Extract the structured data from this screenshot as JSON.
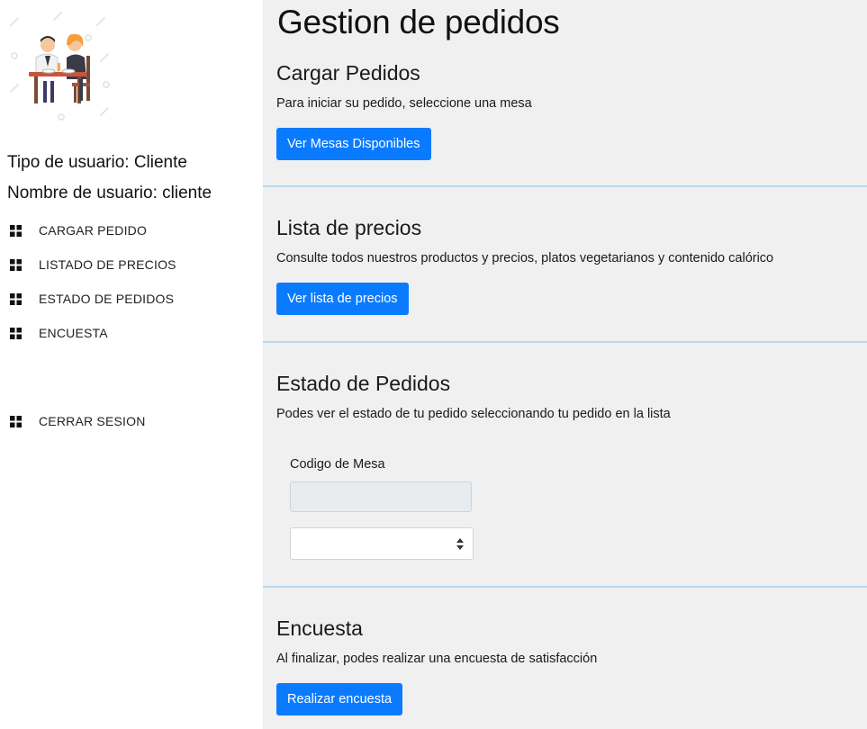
{
  "sidebar": {
    "user_type": "Tipo de usuario: Cliente",
    "user_name": "Nombre de usuario: cliente",
    "nav": [
      {
        "label": "CARGAR PEDIDO",
        "icon": "grid-icon"
      },
      {
        "label": "LISTADO DE PRECIOS",
        "icon": "grid-icon"
      },
      {
        "label": "ESTADO DE PEDIDOS",
        "icon": "grid-icon"
      },
      {
        "label": "ENCUESTA",
        "icon": "grid-icon"
      },
      {
        "label": "CERRAR SESION",
        "icon": "grid-icon"
      }
    ]
  },
  "main": {
    "title": "Gestion de pedidos",
    "sections": [
      {
        "title": "Cargar Pedidos",
        "text": "Para iniciar su pedido, seleccione una mesa",
        "button": "Ver Mesas Disponibles"
      },
      {
        "title": "Lista de precios",
        "text": "Consulte todos nuestros productos y precios, platos vegetarianos y contenido calórico",
        "button": "Ver lista de precios"
      },
      {
        "title": "Estado de Pedidos",
        "text": "Podes ver el estado de tu pedido seleccionando tu pedido en la lista",
        "field_label": "Codigo de Mesa",
        "field_value": "",
        "select_value": ""
      },
      {
        "title": "Encuesta",
        "text": "Al finalizar, podes realizar una encuesta de satisfacción",
        "button": "Realizar encuesta"
      }
    ]
  },
  "colors": {
    "button_bg": "#0a7bff",
    "main_bg": "#f0f0f0",
    "divider": "#b8d8ec"
  }
}
